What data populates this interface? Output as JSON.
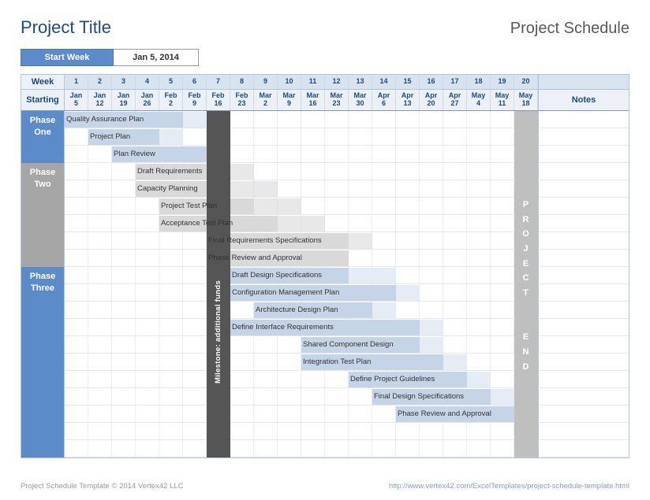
{
  "title": "Project Title",
  "subtitle": "Project Schedule",
  "start_week_label": "Start Week",
  "start_week_value": "Jan 5, 2014",
  "header": {
    "week_label": "Week",
    "starting_label": "Starting",
    "notes_label": "Notes",
    "weeks": [
      1,
      2,
      3,
      4,
      5,
      6,
      7,
      8,
      9,
      10,
      11,
      12,
      13,
      14,
      15,
      16,
      17,
      18,
      19,
      20
    ],
    "dates_top": [
      "Jan",
      "Jan",
      "Jan",
      "Jan",
      "Feb",
      "Feb",
      "Feb",
      "Feb",
      "Mar",
      "Mar",
      "Mar",
      "Mar",
      "Mar",
      "Apr",
      "Apr",
      "Apr",
      "Apr",
      "May",
      "May",
      "May"
    ],
    "dates_bot": [
      "5",
      "12",
      "19",
      "26",
      "2",
      "9",
      "16",
      "23",
      "2",
      "9",
      "16",
      "23",
      "30",
      "6",
      "13",
      "20",
      "27",
      "4",
      "11",
      "18"
    ]
  },
  "phases": {
    "one": "Phase One",
    "two": "Phase Two",
    "three": "Phase Three"
  },
  "milestone_label": "Milestone: additional funds",
  "project_end_label": "PROJECT END",
  "footer_left": "Project Schedule Template © 2014 Vertex42 LLC",
  "footer_right": "http://www.vertex42.com/ExcelTemplates/project-schedule-template.html",
  "chart_data": {
    "type": "bar",
    "title": "Project Schedule",
    "x": [
      1,
      2,
      3,
      4,
      5,
      6,
      7,
      8,
      9,
      10,
      11,
      12,
      13,
      14,
      15,
      16,
      17,
      18,
      19,
      20
    ],
    "xlabel": "Week",
    "xlim": [
      1,
      20
    ],
    "milestones": [
      {
        "name": "Milestone: additional funds",
        "week": 7
      },
      {
        "name": "Project End",
        "week": 20
      }
    ],
    "series": [
      {
        "name": "Quality Assurance Plan",
        "phase": "Phase One",
        "start": 1,
        "end": 5,
        "fade_end": 6
      },
      {
        "name": "Project Plan",
        "phase": "Phase One",
        "start": 2,
        "end": 4,
        "fade_end": 5
      },
      {
        "name": "Plan Review",
        "phase": "Phase One",
        "start": 3,
        "end": 6,
        "fade_end": 7
      },
      {
        "name": "Draft Requirements",
        "phase": "Phase Two",
        "start": 4,
        "end": 6,
        "fade_end": 8
      },
      {
        "name": "Capacity Planning",
        "phase": "Phase Two",
        "start": 4,
        "end": 6,
        "fade_end": 9
      },
      {
        "name": "Project Test Plan",
        "phase": "Phase Two",
        "start": 5,
        "end": 8,
        "fade_end": 10
      },
      {
        "name": "Acceptance Test Plan",
        "phase": "Phase Two",
        "start": 5,
        "end": 9,
        "fade_end": 11
      },
      {
        "name": "Final Requirements Specifications",
        "phase": "Phase Two",
        "start": 7,
        "end": 12,
        "fade_end": 13
      },
      {
        "name": "Phase Review and Approval",
        "phase": "Phase Two",
        "start": 7,
        "end": 12,
        "fade_end": 12
      },
      {
        "name": "Draft Design Specifications",
        "phase": "Phase Three",
        "start": 8,
        "end": 12,
        "fade_end": 14
      },
      {
        "name": "Configuration Management Plan",
        "phase": "Phase Three",
        "start": 8,
        "end": 14,
        "fade_end": 15
      },
      {
        "name": "Architecture Design Plan",
        "phase": "Phase Three",
        "start": 9,
        "end": 13,
        "fade_end": 14
      },
      {
        "name": "Define Interface Requirements",
        "phase": "Phase Three",
        "start": 8,
        "end": 15,
        "fade_end": 16
      },
      {
        "name": "Shared Component Design",
        "phase": "Phase Three",
        "start": 11,
        "end": 15,
        "fade_end": 16
      },
      {
        "name": "Integration Test Plan",
        "phase": "Phase Three",
        "start": 11,
        "end": 16,
        "fade_end": 17
      },
      {
        "name": "Define Project Guidelines",
        "phase": "Phase Three",
        "start": 13,
        "end": 17,
        "fade_end": 18
      },
      {
        "name": "Final Design Specifications",
        "phase": "Phase Three",
        "start": 14,
        "end": 18,
        "fade_end": 19
      },
      {
        "name": "Phase Review and Approval",
        "phase": "Phase Three",
        "start": 15,
        "end": 19,
        "fade_end": 20
      }
    ]
  },
  "tasks_phase_two_grey_rows": 6
}
